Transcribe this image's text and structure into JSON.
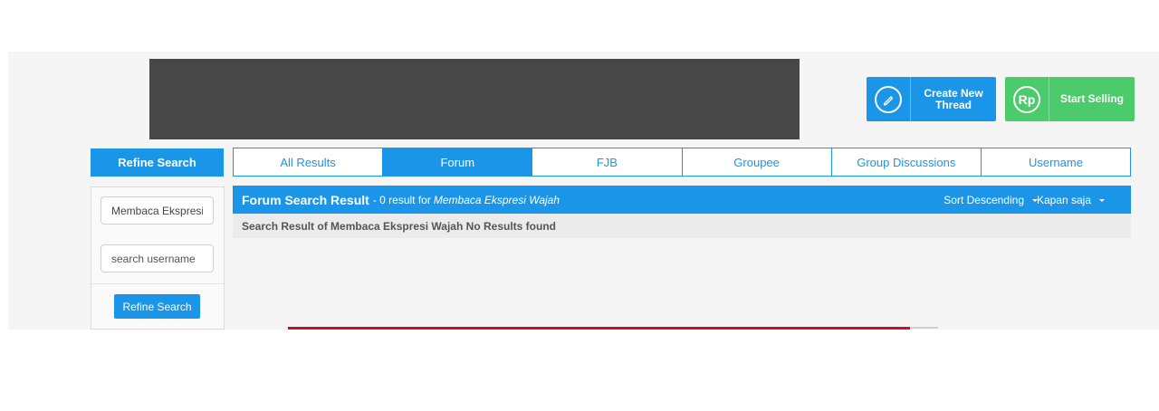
{
  "header": {
    "create_thread": {
      "icon": "pencil-icon",
      "line1": "Create New",
      "line2": "Thread"
    },
    "start_selling": {
      "icon": "rupiah-icon",
      "icon_text": "Rp",
      "label": "Start Selling"
    }
  },
  "refine": {
    "heading": "Refine Search",
    "keyword_value": "Membaca Ekspresi",
    "username_placeholder": "search username",
    "button_label": "Refine Search"
  },
  "tabs": [
    {
      "label": "All Results",
      "active": false
    },
    {
      "label": "Forum",
      "active": true
    },
    {
      "label": "FJB",
      "active": false
    },
    {
      "label": "Groupee",
      "active": false
    },
    {
      "label": "Group Discussions",
      "active": false
    },
    {
      "label": "Username",
      "active": false
    }
  ],
  "result": {
    "title": "Forum Search Result",
    "summary": "- 0 result for",
    "query": "Membaca Ekspresi Wajah",
    "sort_label": "Sort Descending",
    "time_label": "Kapan saja",
    "message": "Search Result of Membaca Ekspresi Wajah No Results found"
  },
  "colors": {
    "accent": "#1b95e8",
    "sell_green": "#4ccb6d",
    "banner": "#474747",
    "bottom_bar": "#c8102e"
  }
}
